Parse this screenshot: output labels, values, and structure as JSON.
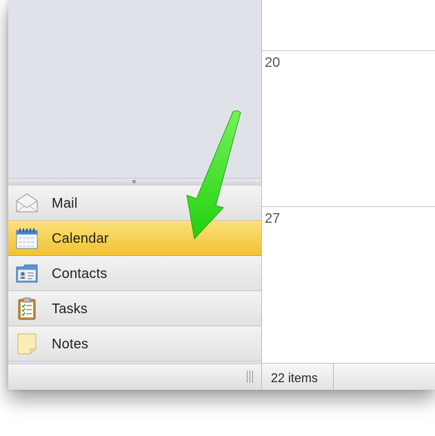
{
  "navigation": {
    "items": [
      {
        "label": "Mail",
        "icon": "mail-icon",
        "active": false
      },
      {
        "label": "Calendar",
        "icon": "calendar-icon",
        "active": true
      },
      {
        "label": "Contacts",
        "icon": "contacts-icon",
        "active": false
      },
      {
        "label": "Tasks",
        "icon": "tasks-icon",
        "active": false
      },
      {
        "label": "Notes",
        "icon": "notes-icon",
        "active": false
      }
    ]
  },
  "calendar": {
    "days": [
      "20",
      "27"
    ]
  },
  "status": {
    "items_count": "22 items"
  },
  "colors": {
    "active_accent": "#f5c93c",
    "annotation_arrow": "#3ee61f",
    "sidebar_background": "#dfe2e9"
  },
  "annotation": {
    "icon": "green-arrow-icon"
  }
}
